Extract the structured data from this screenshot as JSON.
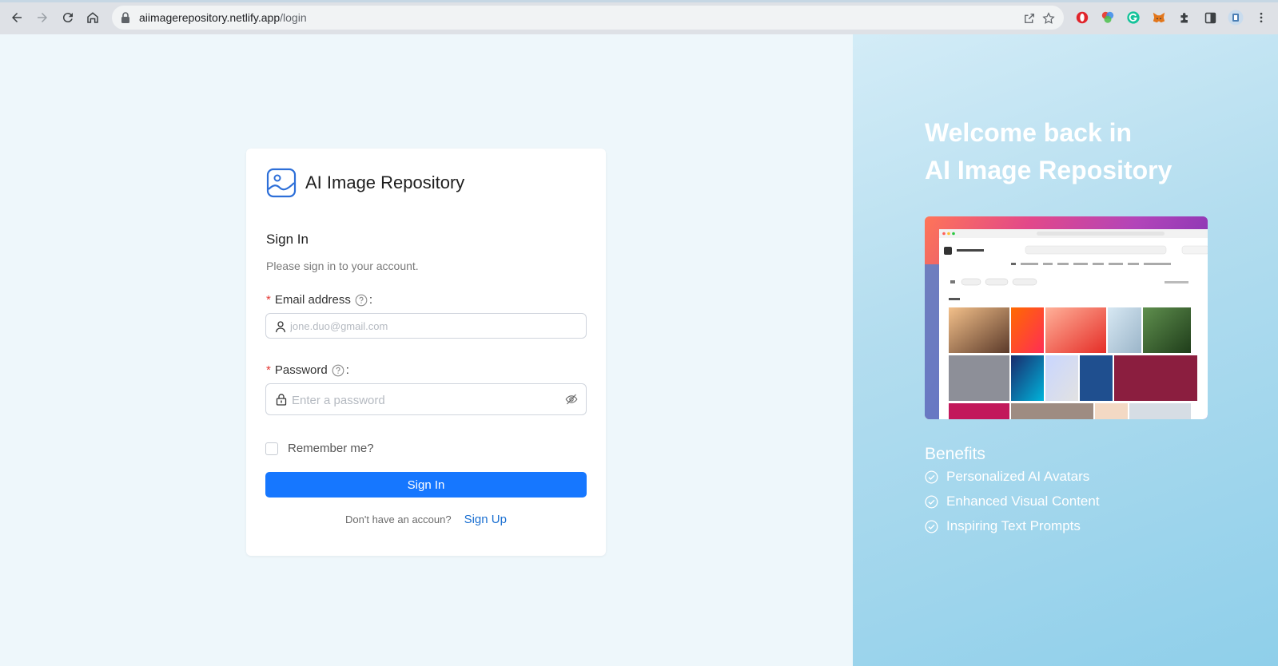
{
  "browser": {
    "url_host": "aiimagerepository.netlify.app",
    "url_path": "/login"
  },
  "login": {
    "brand_name": "AI Image Repository",
    "heading": "Sign In",
    "subheading": "Please sign in to your account.",
    "email": {
      "label": "Email address",
      "label_suffix": ":",
      "required_mark": "*",
      "placeholder": "jone.duo@gmail.com",
      "value": ""
    },
    "password": {
      "label": "Password",
      "label_suffix": ":",
      "required_mark": "*",
      "placeholder": "Enter a password",
      "value": ""
    },
    "remember_label": "Remember me?",
    "remember_checked": false,
    "submit_label": "Sign In",
    "signup_prompt": "Don't have an accoun?",
    "signup_link": "Sign Up"
  },
  "promo": {
    "welcome_line1": "Welcome back in",
    "welcome_line2": "AI Image Repository",
    "benefits_title": "Benefits",
    "benefits": [
      "Personalized AI Avatars",
      "Enhanced Visual Content",
      "Inspiring Text Prompts"
    ]
  },
  "colors": {
    "primary": "#1677ff",
    "link": "#1a6fd1",
    "required": "#e53935",
    "left_background": "#eef7fb",
    "right_gradient_start": "#d3ecf7",
    "right_gradient_end": "#8fcfea"
  },
  "icons": {
    "back": "back-arrow-icon",
    "forward": "forward-arrow-icon",
    "reload": "reload-icon",
    "home": "home-icon",
    "lock": "lock-icon",
    "share": "share-icon",
    "bookmark": "star-icon",
    "user": "user-icon",
    "password": "padlock-icon",
    "toggle_visibility": "eye-slash-icon",
    "help": "question-circle-icon",
    "benefit": "check-circle-icon"
  }
}
